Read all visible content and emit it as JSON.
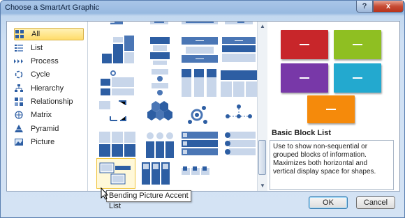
{
  "window": {
    "title": "Choose a SmartArt Graphic",
    "help": "?",
    "close": "x"
  },
  "categories": [
    {
      "label": "All",
      "icon": "grid-icon"
    },
    {
      "label": "List",
      "icon": "list-icon"
    },
    {
      "label": "Process",
      "icon": "process-icon"
    },
    {
      "label": "Cycle",
      "icon": "cycle-icon"
    },
    {
      "label": "Hierarchy",
      "icon": "hierarchy-icon"
    },
    {
      "label": "Relationship",
      "icon": "relationship-icon"
    },
    {
      "label": "Matrix",
      "icon": "matrix-icon"
    },
    {
      "label": "Pyramid",
      "icon": "pyramid-icon"
    },
    {
      "label": "Picture",
      "icon": "picture-icon"
    }
  ],
  "selected_category": "All",
  "preview": {
    "title": "Basic Block List",
    "description": "Use to show non-sequential or grouped blocks of information. Maximizes both horizontal and vertical display space for shapes.",
    "colors": {
      "red": "#c8262a",
      "green": "#8fbf22",
      "purple": "#7838a8",
      "cyan": "#23a9cf",
      "orange": "#f58a0b"
    }
  },
  "tooltip": "Bending Picture Accent List",
  "buttons": {
    "ok": "OK",
    "cancel": "Cancel"
  }
}
